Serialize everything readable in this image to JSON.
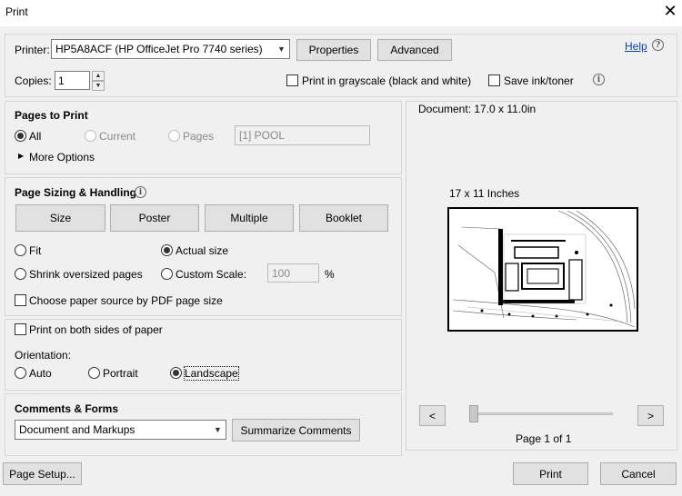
{
  "window": {
    "title": "Print",
    "close_glyph": "✕"
  },
  "printer": {
    "label": "Printer:",
    "selected": "HP5A8ACF (HP OfficeJet Pro 7740 series)",
    "properties_label": "Properties",
    "advanced_label": "Advanced",
    "help_label": "Help"
  },
  "copies": {
    "label": "Copies:",
    "value": "1"
  },
  "options": {
    "grayscale_label": "Print in grayscale (black and white)",
    "save_ink_label": "Save ink/toner"
  },
  "pages_to_print": {
    "title": "Pages to Print",
    "all_label": "All",
    "current_label": "Current",
    "pages_label": "Pages",
    "pages_value": "[1] POOL",
    "more_options_label": "More Options"
  },
  "sizing": {
    "title": "Page Sizing & Handling",
    "tabs": [
      "Size",
      "Poster",
      "Multiple",
      "Booklet"
    ],
    "fit_label": "Fit",
    "actual_size_label": "Actual size",
    "shrink_label": "Shrink oversized pages",
    "custom_scale_label": "Custom Scale:",
    "custom_scale_value": "100",
    "percent_label": "%",
    "paper_source_label": "Choose paper source by PDF page size"
  },
  "duplex": {
    "both_sides_label": "Print on both sides of paper"
  },
  "orientation": {
    "label": "Orientation:",
    "auto_label": "Auto",
    "portrait_label": "Portrait",
    "landscape_label": "Landscape"
  },
  "comments": {
    "title": "Comments & Forms",
    "selected": "Document and Markups",
    "summarize_label": "Summarize Comments"
  },
  "preview": {
    "document_label": "Document: 17.0 x 11.0in",
    "paper_label": "17 x 11 Inches",
    "prev_label": "<",
    "next_label": ">",
    "page_label": "Page 1 of 1"
  },
  "footer": {
    "page_setup_label": "Page Setup...",
    "print_label": "Print",
    "cancel_label": "Cancel"
  }
}
